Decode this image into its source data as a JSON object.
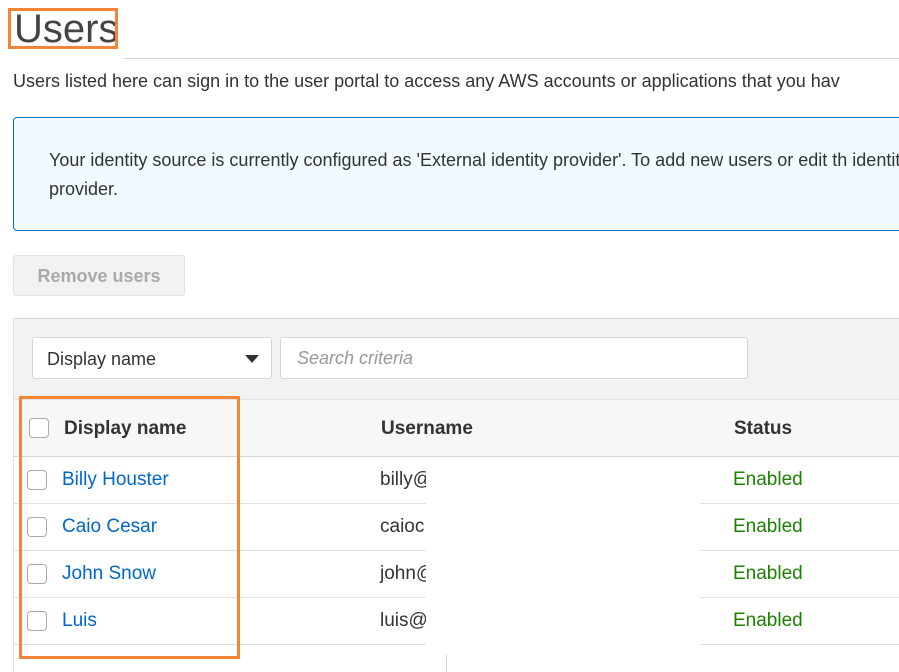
{
  "page": {
    "title": "Users",
    "description": "Users listed here can sign in to the user portal to access any AWS accounts or applications that you hav"
  },
  "info_box": {
    "text": "Your identity source is currently configured as 'External identity provider'. To add new users or edit th identity provider."
  },
  "toolbar": {
    "remove_label": "Remove users"
  },
  "filter": {
    "selected_attribute": "Display name",
    "search_placeholder": "Search criteria"
  },
  "table": {
    "columns": [
      "Display name",
      "Username",
      "Status"
    ],
    "rows": [
      {
        "display_name": "Billy Houster",
        "username": "billy@",
        "status": "Enabled"
      },
      {
        "display_name": "Caio Cesar",
        "username": "caioc",
        "status": "Enabled"
      },
      {
        "display_name": "John Snow",
        "username": "john@",
        "status": "Enabled"
      },
      {
        "display_name": "Luis",
        "username": "luis@",
        "status": "Enabled"
      }
    ]
  },
  "colors": {
    "accent_highlight": "#f58536",
    "link": "#0066cc",
    "status_enabled": "#1d8102",
    "info_border": "#0073bb",
    "info_background": "#f1faff"
  }
}
